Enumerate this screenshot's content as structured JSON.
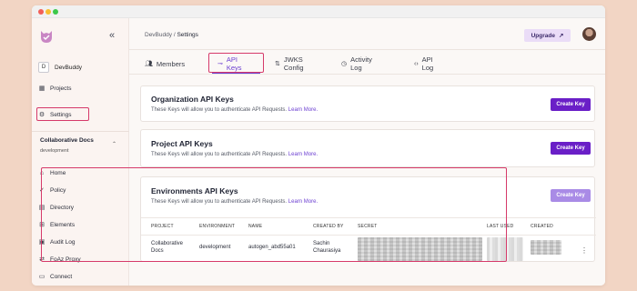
{
  "sidebar": {
    "collapse_icon": "chevron-double-left-icon",
    "workspace": {
      "badge": "D",
      "name": "DevBuddy"
    },
    "top_items": [
      {
        "label": "Projects",
        "icon": "grid-icon"
      },
      {
        "label": "Settings",
        "icon": "gear-icon"
      }
    ],
    "project": {
      "name": "Collaborative Docs",
      "env": "development"
    },
    "items": [
      {
        "label": "Home",
        "icon": "home-icon"
      },
      {
        "label": "Policy",
        "icon": "policy-icon"
      },
      {
        "label": "Directory",
        "icon": "directory-icon"
      },
      {
        "label": "Elements",
        "icon": "elements-icon"
      },
      {
        "label": "Audit Log",
        "icon": "audit-log-icon"
      },
      {
        "label": "FoAz Proxy",
        "icon": "proxy-icon"
      },
      {
        "label": "Connect",
        "icon": "connect-icon"
      }
    ]
  },
  "header": {
    "breadcrumb_root": "DevBuddy",
    "breadcrumb_sep": "/",
    "breadcrumb_current": "Settings",
    "upgrade_label": "Upgrade",
    "upgrade_icon": "↗"
  },
  "tabs": [
    {
      "label": "Members",
      "icon": "users-icon"
    },
    {
      "label": "API Keys",
      "icon": "key-icon",
      "active": true
    },
    {
      "label": "JWKS Config",
      "icon": "arrows-icon"
    },
    {
      "label": "Activity Log",
      "icon": "clock-icon"
    },
    {
      "label": "API Log",
      "icon": "code-icon"
    }
  ],
  "cards": {
    "org": {
      "title": "Organization API Keys",
      "desc": "These Keys will allow you to authenticate API Requests.",
      "link": "Learn More.",
      "button": "Create Key"
    },
    "project": {
      "title": "Project API Keys",
      "desc": "These Keys will allow you to authenticate API Requests.",
      "link": "Learn More.",
      "button": "Create Key"
    },
    "env": {
      "title": "Environments API Keys",
      "desc": "These Keys will allow you to authenticate API Requests.",
      "link": "Learn More.",
      "button": "Create Key",
      "columns": [
        "PROJECT",
        "ENVIRONMENT",
        "NAME",
        "CREATED BY",
        "SECRET",
        "LAST USED",
        "CREATED"
      ],
      "rows": [
        {
          "project_line1": "Collaborative",
          "project_line2": "Docs",
          "environment": "development",
          "name": "autogen_abd55a01",
          "created_by_line1": "Sachin",
          "created_by_line2": "Chaurasiya"
        }
      ]
    }
  },
  "colors": {
    "accent": "#6a1fc7",
    "highlight": "#d63a6a",
    "background": "#f2d5c4"
  }
}
